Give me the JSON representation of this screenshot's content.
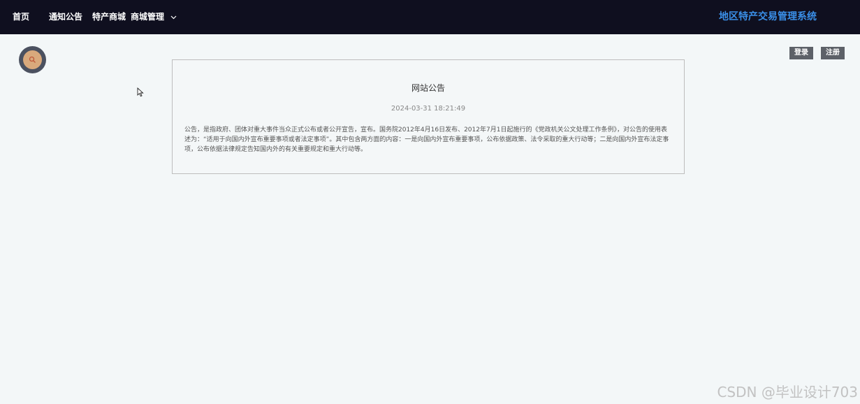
{
  "nav": {
    "home": "首页",
    "notices": "通知公告",
    "mall": "特产商城",
    "mall_manage": "商城管理"
  },
  "brand": "地区特产交易管理系统",
  "auth": {
    "login": "登录",
    "register": "注册"
  },
  "notice": {
    "title": "网站公告",
    "time": "2024-03-31 18:21:49",
    "body": "公告，是指政府、团体对重大事件当众正式公布或者公开宣告，宣布。国务院2012年4月16日发布、2012年7月1日起施行的《党政机关公文处理工作条例》，对公告的使用表述为：“适用于向国内外宣布重要事项或者法定事项”。其中包含两方面的内容：一是向国内外宣布重要事项，公布依据政策、法令采取的重大行动等；二是向国内外宣布法定事项，公布依据法律规定告知国内外的有关重要规定和重大行动等。"
  },
  "watermark": "CSDN @毕业设计703",
  "icons": {
    "avatar": "search-icon",
    "dropdown": "chevron-down-icon",
    "cursor": "mouse-pointer-icon"
  },
  "colors": {
    "topbar": "#0f0f1f",
    "brand": "#3a8fe8",
    "button": "#5d6168",
    "background": "#f3f7f8"
  }
}
